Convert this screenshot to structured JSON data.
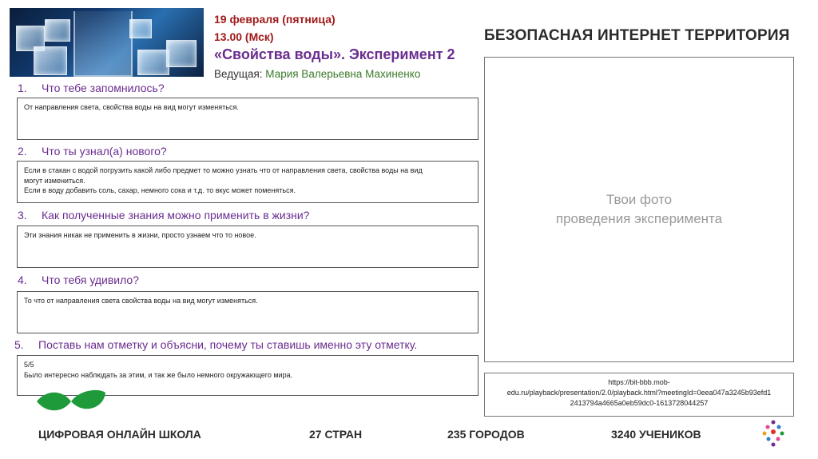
{
  "header": {
    "date": "19 февраля (пятница)",
    "time": "13.00 (Мск)",
    "title": "«Свойства воды». Эксперимент 2",
    "host_label": "Ведущая:",
    "host_name": "Мария Валерьевна Махиненко",
    "brand": "БЕЗОПАСНАЯ ИНТЕРНЕТ ТЕРРИТОРИЯ"
  },
  "questions": [
    {
      "num": "1.",
      "text": "Что тебе запомнилось?",
      "answer": "От направления света, свойства воды на вид могут изменяться."
    },
    {
      "num": "2.",
      "text": "Что ты узнал(а) нового?",
      "answer": "Если в стакан с водой погрузить какой либо предмет то можно узнать что от направления света, свойства воды на вид\nмогут измениться.\nЕсли в воду добавить соль, сахар, немного сока и т.д. то вкус может поменяться."
    },
    {
      "num": "3.",
      "text": "Как полученные знания можно применить в жизни?",
      "answer": "Эти знания никак не применить в жизни, просто узнаем что то новое."
    },
    {
      "num": "4.",
      "text": "Что тебя удивило?",
      "answer": "То что от направления света свойства воды на вид могут изменяться."
    },
    {
      "num": "5.",
      "text": "Поставь нам отметку и объясни, почему ты ставишь именно эту отметку.",
      "answer": "5/5\nБыло интересно наблюдать за этим, и так же было немного окружающего мира."
    }
  ],
  "photo_placeholder": {
    "line1": "Твои фото",
    "line2": "проведения эксперимента"
  },
  "link": {
    "line1": "https://bit-bbb.mob-",
    "line2": "edu.ru/playback/presentation/2.0/playback.html?meetingId=0eea047a3245b93efd1",
    "line3": "2413794a4665a0eb59dc0-1613728044257"
  },
  "footer": {
    "school": "ЦИФРОВАЯ ОНЛАЙН ШКОЛА",
    "countries": "27 СТРАН",
    "cities": "235  ГОРОДОВ",
    "students": "3240 УЧЕНИКОВ"
  },
  "colors": {
    "accent_purple": "#6a2d8f",
    "date_red": "#a01a1a",
    "host_green": "#3c7a2a",
    "leaf_green": "#1f9a3a"
  }
}
